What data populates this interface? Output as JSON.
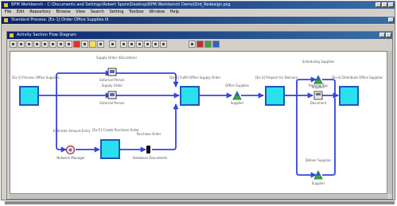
{
  "app": {
    "title": "BPM Workbench - C:\\Documents and Settings\\Robert Spore\\Desktop\\BPM Workbench Demo\\Ord_Redesign.psg"
  },
  "menu": [
    "File",
    "Edit",
    "Repository",
    "Browse",
    "View",
    "Search",
    "Setting",
    "Toolbox",
    "Window",
    "Help"
  ],
  "model_window": {
    "title": "Standard Process: [Ex-1] Order Office Supplies III"
  },
  "diagram_window": {
    "title": "Activity Section Flow Diagram"
  },
  "diagram": {
    "start_node": "[Ex-1] Process Office Supplies",
    "approve_node": "[Ex-2] Fulfill Office Supply Order",
    "prepare_node": "[Ex-3] Prepare for Delivery",
    "distribute_node": "[Ex-4] Distribute Office Supplies",
    "po_node": "[Ex-5] Create Purchase Order",
    "supply_order_discr": "Supply Order (Discretion)",
    "supply_order": "Supply Order",
    "estimate_amount": "Estimate Amount Entry",
    "purchase_order": "Purchase Order",
    "office_supplies": "Office Supplies",
    "packing_slip": "Packing Slip",
    "scheduling_supplies": "Scheduling Supplies",
    "deliver_supplies": "Deliver Supplies",
    "external_person_1": "External Person",
    "external_person_2": "External Person",
    "network_manager": "Network Manager",
    "database_documents": "Database Documents",
    "supplier_1": "Supplier",
    "supplier_2": "Supplier",
    "supplier_3": "Supplier",
    "document": "Document"
  },
  "colors": {
    "node_fill": "#29e0ee",
    "node_border": "#1e56b8",
    "flow_line": "#3344dd",
    "titlebar": "#0a246a"
  }
}
